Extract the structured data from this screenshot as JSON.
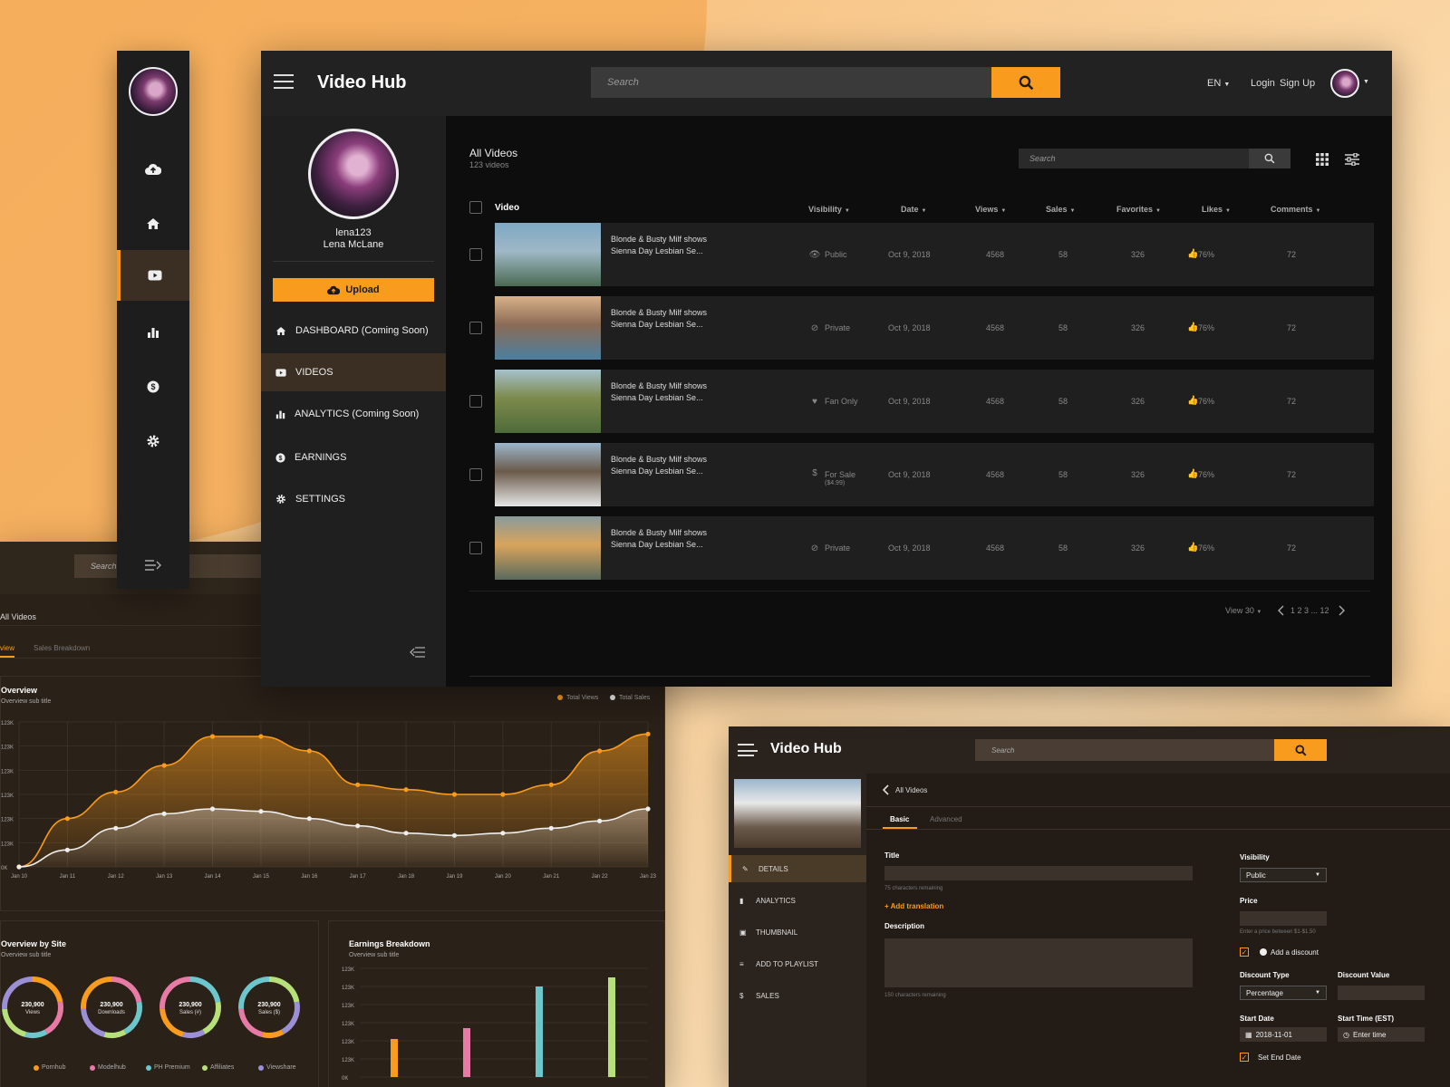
{
  "app": {
    "title": "Video Hub"
  },
  "header": {
    "search_placeholder": "Search",
    "lang": "EN",
    "login": "Login",
    "signup": "Sign Up"
  },
  "profile": {
    "username": "lena123",
    "fullname": "Lena McLane"
  },
  "sidebar": {
    "upload": "Upload",
    "items": [
      {
        "label": "DASHBOARD (Coming Soon)",
        "icon": "home-icon"
      },
      {
        "label": "VIDEOS",
        "icon": "video-icon"
      },
      {
        "label": "ANALYTICS  (Coming Soon)",
        "icon": "chart-icon"
      },
      {
        "label": "EARNINGS",
        "icon": "dollar-icon"
      },
      {
        "label": "SETTINGS",
        "icon": "gear-icon"
      }
    ]
  },
  "videos": {
    "title": "All Videos",
    "count": "123 videos",
    "search_placeholder": "Search",
    "columns": [
      "Video",
      "Visibility",
      "Date",
      "Views",
      "Sales",
      "Favorites",
      "Likes",
      "Comments"
    ],
    "rows": [
      {
        "title": "Blonde & Busty Milf shows Sienna Day Lesbian Se...",
        "visibility": "Public",
        "price": "",
        "date": "Oct 9, 2018",
        "views": "4568",
        "sales": "58",
        "favorites": "326",
        "likes": "76%",
        "comments": "72",
        "colors": [
          "#7ea8c4",
          "#4a6a52",
          "#9fb8c6"
        ]
      },
      {
        "title": "Blonde & Busty Milf shows Sienna Day Lesbian Se...",
        "visibility": "Private",
        "price": "",
        "date": "Oct 9, 2018",
        "views": "4568",
        "sales": "58",
        "favorites": "326",
        "likes": "76%",
        "comments": "72",
        "colors": [
          "#d9b18a",
          "#4c7fa0",
          "#8a6b55"
        ]
      },
      {
        "title": "Blonde & Busty Milf shows Sienna Day Lesbian Se...",
        "visibility": "Fan Only",
        "price": "",
        "date": "Oct 9, 2018",
        "views": "4568",
        "sales": "58",
        "favorites": "326",
        "likes": "76%",
        "comments": "72",
        "colors": [
          "#a6c1cc",
          "#4e6b3a",
          "#7d8a4c"
        ]
      },
      {
        "title": "Blonde & Busty Milf shows Sienna Day Lesbian Se...",
        "visibility": "For Sale",
        "price": "($4.99)",
        "date": "Oct 9, 2018",
        "views": "4568",
        "sales": "58",
        "favorites": "326",
        "likes": "76%",
        "comments": "72",
        "colors": [
          "#9cb6cc",
          "#e6e6e6",
          "#6a5a4a"
        ]
      },
      {
        "title": "Blonde & Busty Milf shows Sienna Day Lesbian Se...",
        "visibility": "Private",
        "price": "",
        "date": "Oct 9, 2018",
        "views": "4568",
        "sales": "58",
        "favorites": "326",
        "likes": "76%",
        "comments": "72",
        "colors": [
          "#8a9a9c",
          "#5a6a5c",
          "#d9a45c"
        ]
      }
    ],
    "view_per_page": "View 30",
    "pagination": "1 2 3 ... 12"
  },
  "analytics": {
    "search_placeholder": "Search",
    "breadcrumb": "All Videos",
    "tabs": [
      "view",
      "Sales Breakdown"
    ],
    "overview_title": "Overview",
    "overview_sub": "Overview sub title",
    "legend": [
      "Total Views",
      "Total Sales"
    ],
    "site_title": "Overview by Site",
    "site_sub": "Overview sub title",
    "earn_title": "Earnings Breakdown",
    "earn_sub": "Overview sub title",
    "donuts": [
      {
        "value": "230,900",
        "label": "Views"
      },
      {
        "value": "230,900",
        "label": "Downloads"
      },
      {
        "value": "230,900",
        "label": "Sales (#)"
      },
      {
        "value": "230,900",
        "label": "Sales ($)"
      }
    ],
    "site_legend": [
      {
        "name": "Pornhub",
        "color": "#f99b1d"
      },
      {
        "name": "Modelhub",
        "color": "#e87aa6"
      },
      {
        "name": "PH Premium",
        "color": "#6cc6cc"
      },
      {
        "name": "Affiliates",
        "color": "#b7e07a"
      },
      {
        "name": "Viewshare",
        "color": "#9b8fd6"
      }
    ]
  },
  "chart_data": [
    {
      "type": "area",
      "title": "Overview",
      "x": [
        "Jan 10",
        "Jan 11",
        "Jan 12",
        "Jan 13",
        "Jan 14",
        "Jan 15",
        "Jan 16",
        "Jan 17",
        "Jan 18",
        "Jan 19",
        "Jan 20",
        "Jan 21",
        "Jan 22",
        "Jan 23"
      ],
      "y_ticks": [
        "0K",
        "123K",
        "123K",
        "123K",
        "123K",
        "123K",
        "123K"
      ],
      "ylim": [
        0,
        6
      ],
      "series": [
        {
          "name": "Total Views",
          "color": "#f99b1d",
          "values": [
            0,
            2,
            3.1,
            4.2,
            5.4,
            5.4,
            4.8,
            3.4,
            3.2,
            3.0,
            3.0,
            3.4,
            4.8,
            5.5
          ]
        },
        {
          "name": "Total Sales",
          "color": "#eeeeee",
          "values": [
            0,
            0.7,
            1.6,
            2.2,
            2.4,
            2.3,
            2.0,
            1.7,
            1.4,
            1.3,
            1.4,
            1.6,
            1.9,
            2.4
          ]
        }
      ]
    },
    {
      "type": "bar",
      "title": "Earnings Breakdown",
      "y_ticks": [
        "0K",
        "123K",
        "123K",
        "123K",
        "123K",
        "123K",
        "123K"
      ],
      "ylim": [
        0,
        6
      ],
      "values": [
        2.1,
        2.7,
        5.0,
        5.5
      ],
      "colors": [
        "#f99b1d",
        "#e87aa6",
        "#6cc6cc",
        "#b7e07a"
      ]
    }
  ],
  "edit": {
    "search_placeholder": "Search",
    "back": "All Videos",
    "tabs": [
      "Basic",
      "Advanced"
    ],
    "side": [
      "DETAILS",
      "ANALYTICS",
      "THUMBNAIL",
      "ADD TO PLAYLIST",
      "SALES"
    ],
    "title_label": "Title",
    "title_hint": "75 characters remaining",
    "add_translation": "+ Add translation",
    "desc_label": "Description",
    "desc_hint": "150 characters remaining",
    "visibility_label": "Visibility",
    "visibility_value": "Public",
    "price_label": "Price",
    "price_hint": "Enter a price between $1-$1.50",
    "add_discount": "Add a discount",
    "discount_type_label": "Discount Type",
    "discount_type_value": "Percentage",
    "discount_value_label": "Discount Value",
    "start_date_label": "Start Date",
    "start_date_value": "2018-11-01",
    "start_time_label": "Start Time (EST)",
    "start_time_value": "Enter time",
    "set_end": "Set End Date"
  }
}
